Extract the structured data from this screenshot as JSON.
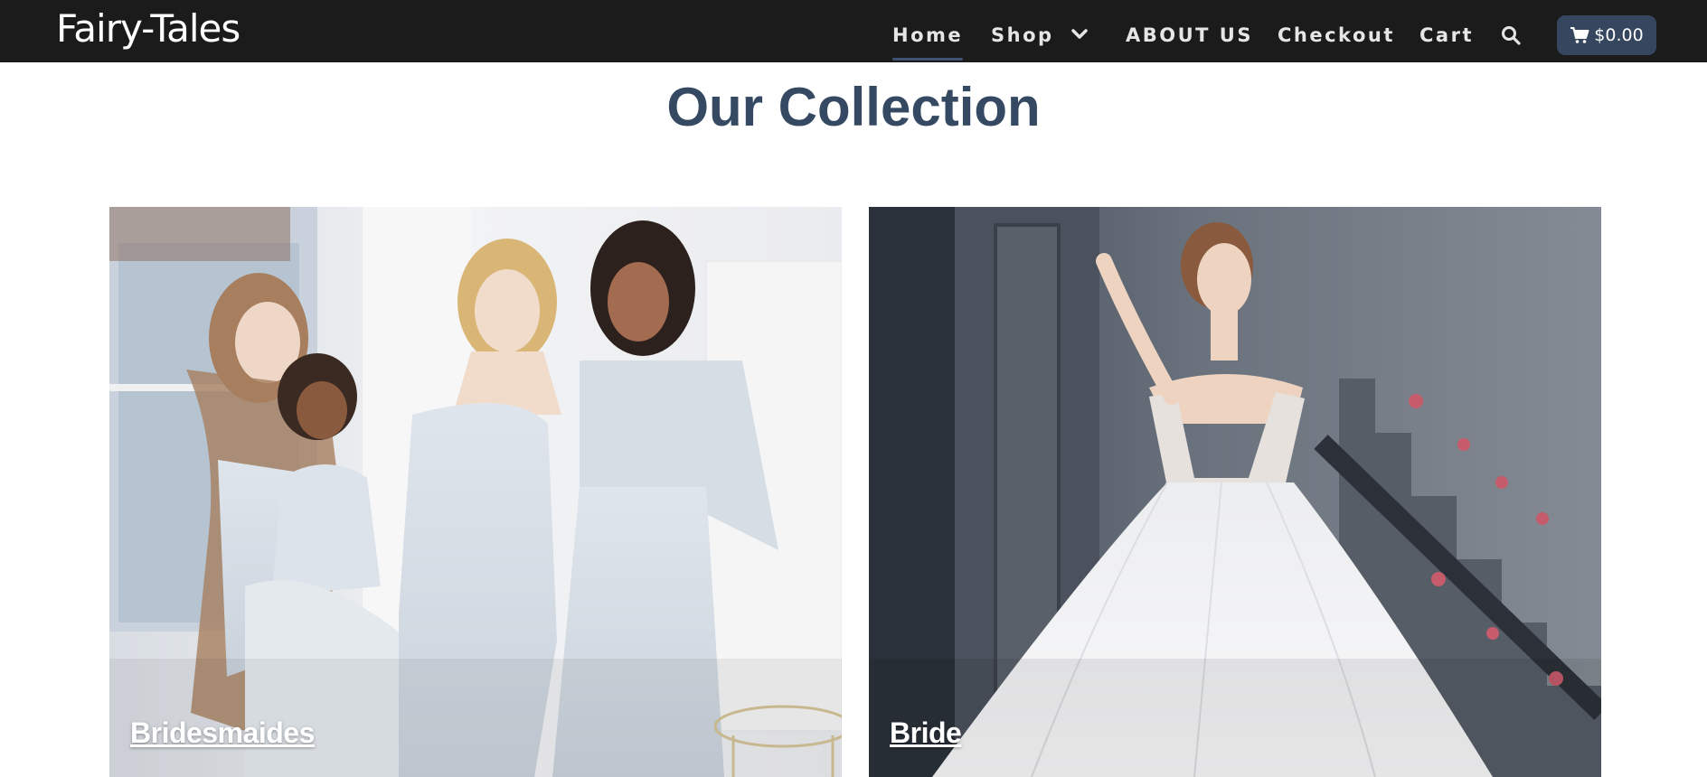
{
  "header": {
    "brand": "Fairy-Tales",
    "nav": {
      "home": "Home",
      "shop": "Shop",
      "about": "ABOUT US",
      "checkout": "Checkout",
      "cart": "Cart"
    },
    "cart_total": "$0.00",
    "active_tab": "Home"
  },
  "main": {
    "title": "Our Collection",
    "cards": [
      {
        "label": "Bridesmaides"
      },
      {
        "label": "Bride"
      }
    ]
  },
  "colors": {
    "header_bg": "#1b1b1b",
    "accent": "#35465e",
    "title": "#354a62"
  },
  "icons": [
    "chevron-down-icon",
    "search-icon",
    "cart-icon"
  ]
}
